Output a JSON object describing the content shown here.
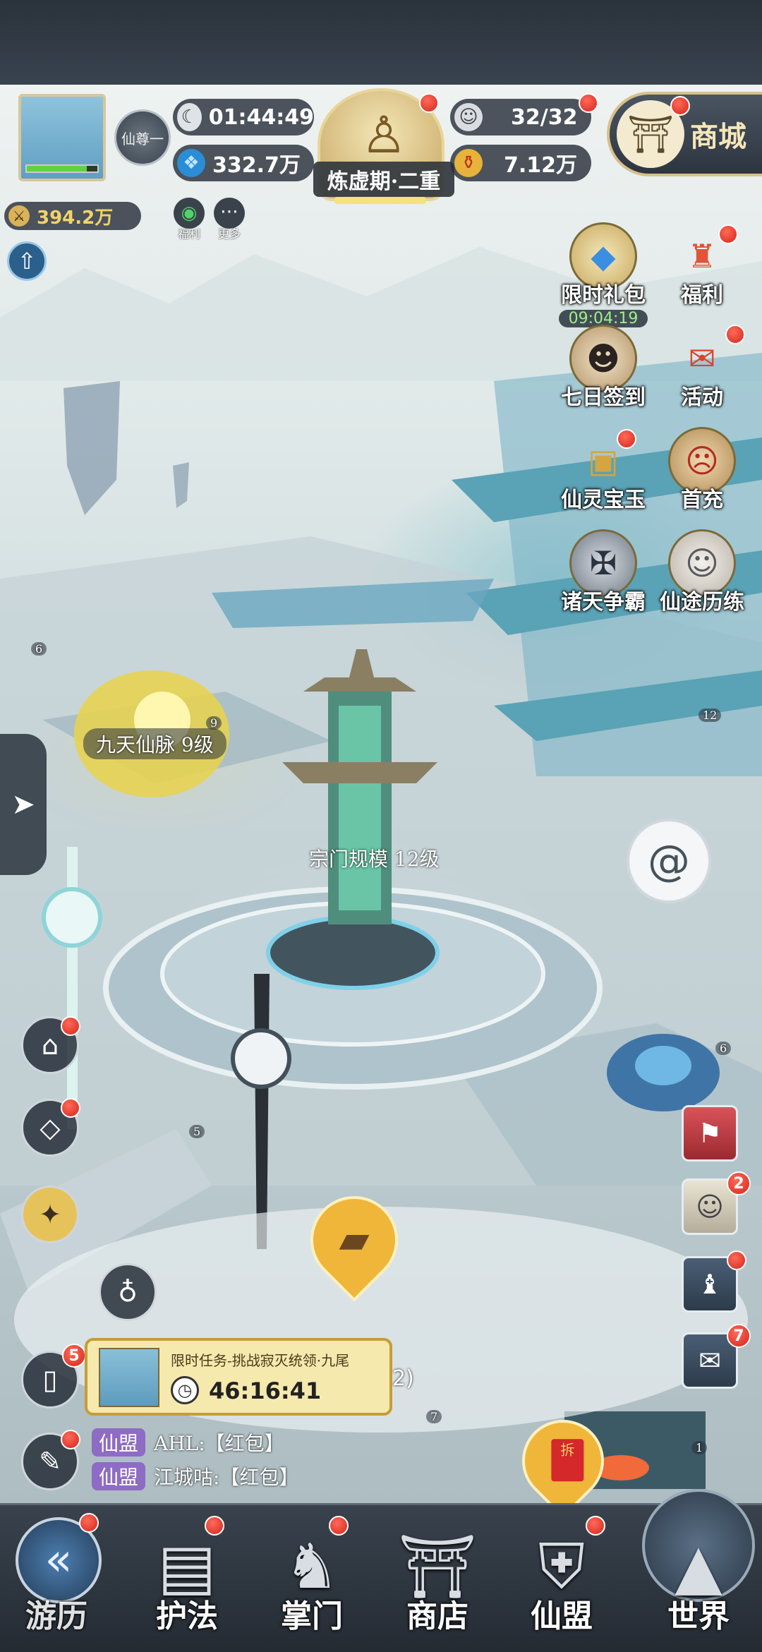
{
  "header": {
    "rank_badge": "仙尊一",
    "timer": "01:44:49",
    "spirit_stones": "332.7万",
    "realm": "炼虚期·二重",
    "stamina": "32/32",
    "power": "7.12万",
    "shop": "商城",
    "silver": "394.2万",
    "welfare_small": "福利",
    "more_small": "更多"
  },
  "right_menu": {
    "limited_pack": "限时礼包",
    "limited_timer": "09:04:19",
    "welfare": "福利",
    "seven_day": "七日签到",
    "activity": "活动",
    "spirit_treasure": "仙灵宝玉",
    "first_charge": "首充",
    "heavens_contest": "诸天争霸",
    "immortal_trial": "仙途历练"
  },
  "map_labels": {
    "vein": "九天仙脉 9级",
    "sect": "宗门规模 12级",
    "lvl_6a": "6",
    "lvl_9": "9",
    "lvl_12": "12",
    "lvl_5": "5",
    "lvl_6b": "6",
    "lvl_7": "7",
    "lvl_1": "1"
  },
  "task": {
    "title": "限时任务-挑战寂灭统领·九尾",
    "timer": "46:16:41",
    "badge": "5",
    "suffix": "2)"
  },
  "chat": [
    {
      "tag": "仙盟",
      "text": "AHL:【红包】"
    },
    {
      "tag": "仙盟",
      "text": "江城咕:【红包】"
    }
  ],
  "right_side": {
    "friends_badge": "2",
    "mail_badge": "7"
  },
  "red_packet_label": "拆",
  "nav": {
    "adventure": "游历",
    "guardian": "护法",
    "sect_head": "掌门",
    "store": "商店",
    "alliance": "仙盟",
    "world": "世界"
  },
  "colors": {
    "gold": "#f2d36b",
    "panel": "#28303a",
    "badge_red": "#d3261b",
    "alliance_purple": "#8e6bc4"
  }
}
